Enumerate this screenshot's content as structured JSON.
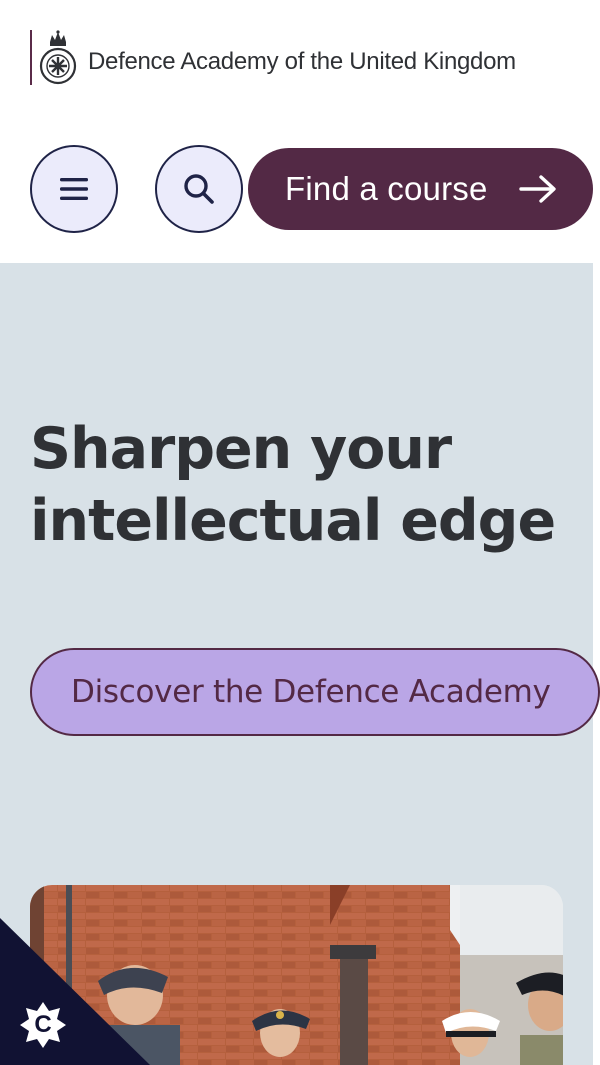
{
  "header": {
    "logo_icon": "royal-crest-icon",
    "site_name": "Defence Academy of the United Kingdom",
    "menu_icon": "hamburger-menu-icon",
    "search_icon": "search-icon",
    "find_course_label": "Find a course",
    "find_course_icon": "arrow-right-icon"
  },
  "hero": {
    "title_line1": "Sharpen your",
    "title_line2": "intellectual edge",
    "cta_label": "Discover the Defence Academy",
    "image_icon": "personnel-photo"
  },
  "cookie": {
    "icon": "cookie-settings-icon",
    "letter": "C"
  },
  "colors": {
    "brand_plum": "#532945",
    "navy": "#1f2347",
    "hero_bg": "#d8e1e7",
    "lavender": "#baa6e6",
    "button_fill": "#ebebfb",
    "cookie_bg": "#111233"
  }
}
